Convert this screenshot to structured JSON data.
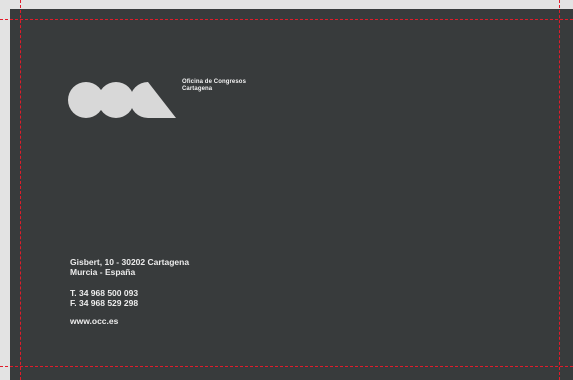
{
  "brand": {
    "name_line_1": "Oficina de Congresos",
    "name_line_2": "Cartagena",
    "logo_icon": "occ-logo-icon"
  },
  "contact": {
    "address_line_1": "Gisbert, 10 - 30202 Cartagena",
    "address_line_2": "Murcia - España",
    "phone": "T. 34 968 500 093",
    "fax": "F. 34 968 529 298",
    "website": "www.occ.es"
  },
  "colors": {
    "background": "#383b3c",
    "text": "#ececec",
    "logo": "#d8d8d8",
    "crop_marks": "#e31b2a"
  }
}
